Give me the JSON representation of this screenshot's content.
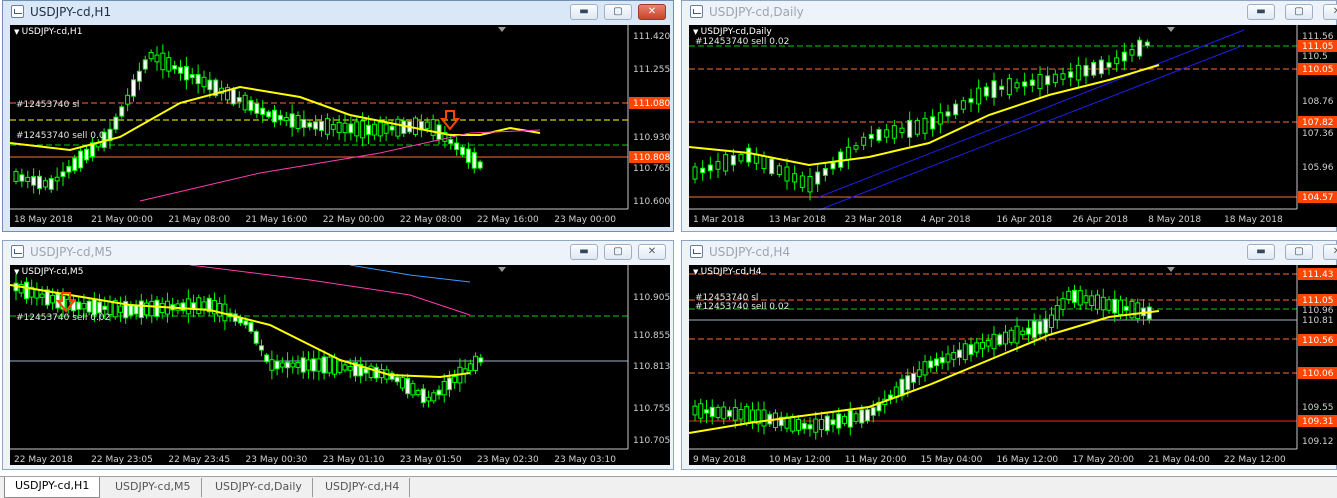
{
  "windows": [
    {
      "id": "h1",
      "title": "USDJPY-cd,H1",
      "symbol": "USDJPY-cd,H1",
      "price_labels": [
        "111.420",
        "111.255",
        "111.080",
        "110.930",
        "110.808",
        "110.765",
        "110.600"
      ],
      "time_labels": [
        "18 May 2018",
        "21 May 00:00",
        "21 May 08:00",
        "21 May 16:00",
        "22 May 00:00",
        "22 May 08:00",
        "22 May 16:00",
        "23 May 00:00"
      ],
      "annotations": [
        "#12453740 sl",
        "#12453740 sell 0.0"
      ],
      "highlighted_prices": [
        "111.080",
        "110.808"
      ]
    },
    {
      "id": "daily",
      "title": "USDJPY-cd,Daily",
      "symbol": "USDJPY-cd,Daily",
      "price_labels": [
        "111.56",
        "111.05",
        "110.5",
        "110.05",
        "108.76",
        "107.82",
        "107.36",
        "105.96",
        "104.57"
      ],
      "time_labels": [
        "1 Mar 2018",
        "13 Mar 2018",
        "23 Mar 2018",
        "4 Apr 2018",
        "16 Apr 2018",
        "26 Apr 2018",
        "8 May 2018",
        "18 May 2018"
      ],
      "annotations": [
        "#12453740 sell 0.02"
      ],
      "highlighted_prices": [
        "111.05",
        "110.05",
        "107.82",
        "104.57"
      ]
    },
    {
      "id": "m5",
      "title": "USDJPY-cd,M5",
      "symbol": "USDJPY-cd,M5",
      "price_labels": [
        "110.905",
        "110.855",
        "110.813",
        "110.755",
        "110.705"
      ],
      "time_labels": [
        "22 May 2018",
        "22 May 23:05",
        "22 May 23:45",
        "23 May 00:30",
        "23 May 01:10",
        "23 May 01:50",
        "23 May 02:30",
        "23 May 03:10"
      ],
      "annotations": [
        "#12453740 sell 0.02"
      ],
      "highlighted_prices": []
    },
    {
      "id": "h4",
      "title": "USDJPY-cd,H4",
      "symbol": "USDJPY-cd,H4",
      "price_labels": [
        "111.43",
        "111.05",
        "110.96",
        "110.81",
        "110.56",
        "110.06",
        "109.55",
        "109.31",
        "109.12"
      ],
      "time_labels": [
        "9 May 2018",
        "10 May 12:00",
        "11 May 20:00",
        "15 May 04:00",
        "16 May 12:00",
        "17 May 20:00",
        "21 May 04:00",
        "22 May 12:00"
      ],
      "annotations": [
        "#12453740 sl",
        "#12453740 sell 0.02"
      ],
      "highlighted_prices": [
        "111.43",
        "111.05",
        "110.56",
        "110.06",
        "109.31"
      ]
    }
  ],
  "tabs": [
    "USDJPY-cd,H1",
    "USDJPY-cd,M5",
    "USDJPY-cd,Daily",
    "USDJPY-cd,H4"
  ],
  "colors": {
    "bull": "#00ff00",
    "bear": "#00ff00",
    "ma": "#ffff00",
    "level": "#ff4500",
    "sell": "#7fff5f",
    "axis": "#c8c8c8",
    "price_tag": "#ff4500"
  }
}
